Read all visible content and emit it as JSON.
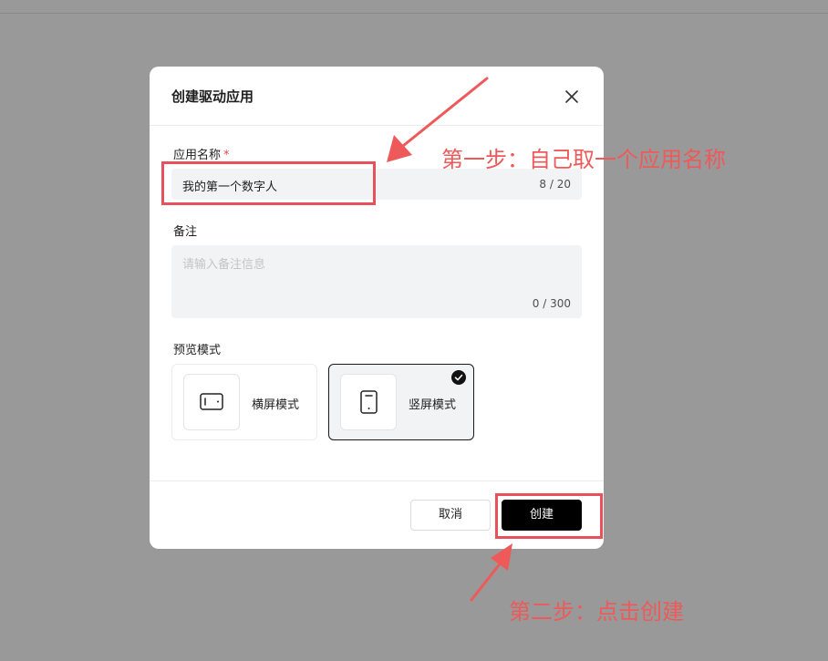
{
  "dialog": {
    "title": "创建驱动应用",
    "close_icon": "close-icon"
  },
  "form": {
    "name_field": {
      "label": "应用名称",
      "required_mark": "*",
      "value": "我的第一个数字人",
      "counter": "8 / 20"
    },
    "note_field": {
      "label": "备注",
      "placeholder": "请输入备注信息",
      "counter": "0 / 300"
    },
    "preview_mode": {
      "label": "预览模式",
      "options": [
        {
          "label": "横屏模式",
          "icon": "landscape-icon",
          "selected": false
        },
        {
          "label": "竖屏模式",
          "icon": "portrait-icon",
          "selected": true
        }
      ]
    }
  },
  "footer": {
    "cancel_label": "取消",
    "create_label": "创建"
  },
  "annotations": {
    "step1": "第一步：自己取一个应用名称",
    "step2": "第二步：点击创建",
    "color": "#ee5a5a"
  },
  "colors": {
    "backdrop": "#999999",
    "primary_button": "#000000",
    "required": "#e24b4b"
  }
}
